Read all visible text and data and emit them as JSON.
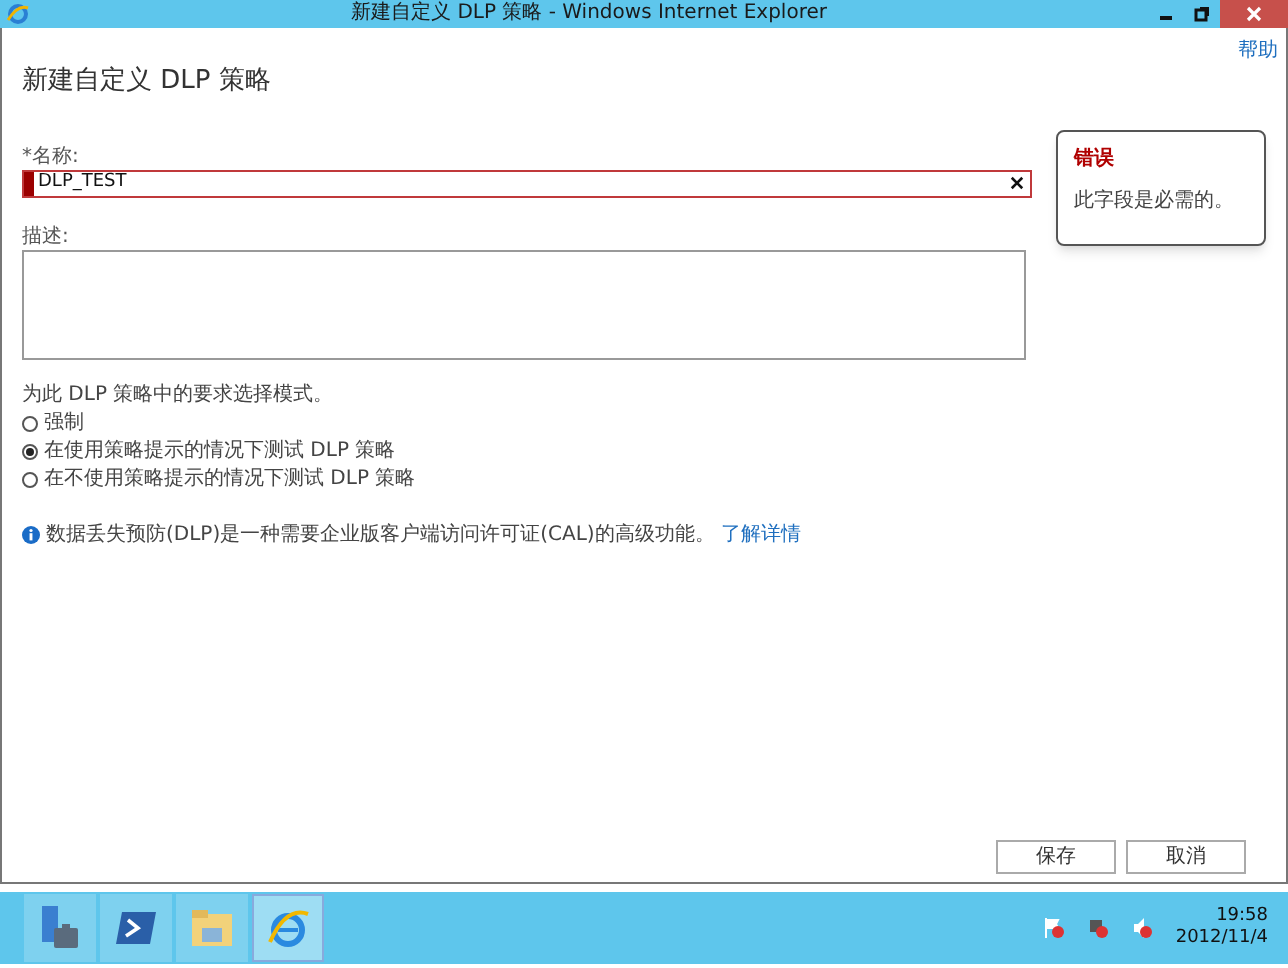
{
  "window": {
    "title": "新建自定义 DLP 策略 - Windows Internet Explorer"
  },
  "help_link": "帮助",
  "heading": "新建自定义 DLP 策略",
  "name_field": {
    "label": "*名称:",
    "value": "DLP_TEST",
    "invalid": true
  },
  "error_callout": {
    "title": "错误",
    "message": "此字段是必需的。"
  },
  "description_field": {
    "label": "描述:"
  },
  "mode": {
    "prompt": "为此 DLP 策略中的要求选择模式。",
    "options": [
      {
        "label": "强制",
        "selected": false
      },
      {
        "label": "在使用策略提示的情况下测试 DLP 策略",
        "selected": true
      },
      {
        "label": "在不使用策略提示的情况下测试 DLP 策略",
        "selected": false
      }
    ]
  },
  "info": {
    "text": "数据丢失预防(DLP)是一种需要企业版客户端访问许可证(CAL)的高级功能。",
    "link": "了解详情"
  },
  "buttons": [
    "保存",
    "取消"
  ],
  "taskbar": {
    "clock_time": "19:58",
    "clock_date": "2012/11/4"
  }
}
